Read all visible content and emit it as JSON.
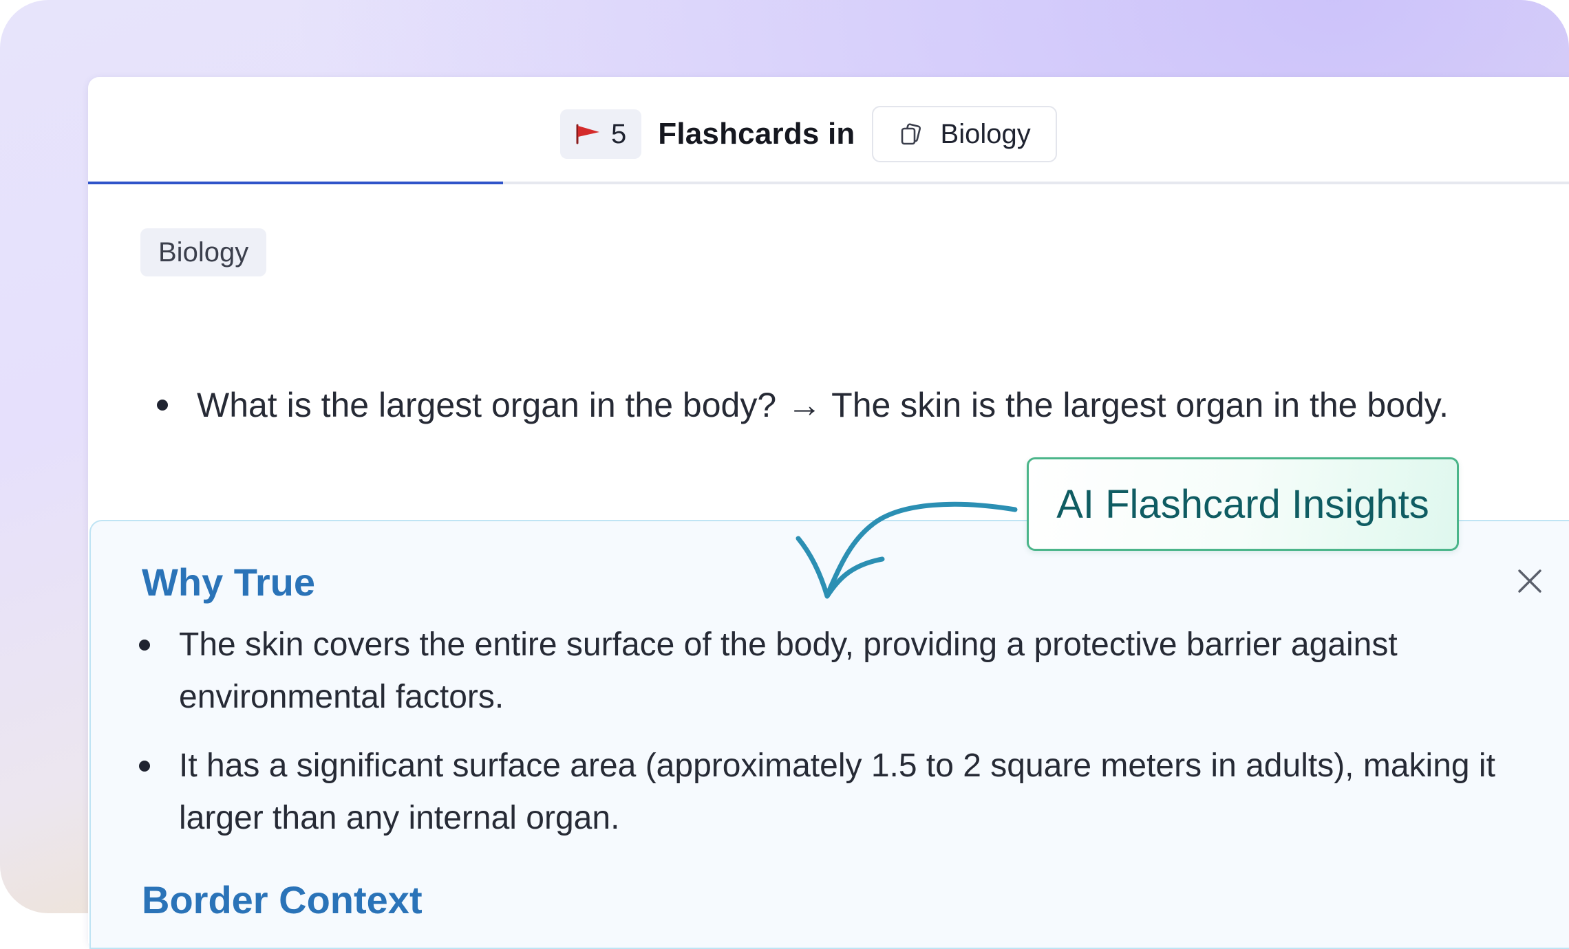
{
  "header": {
    "count": "5",
    "title": "Flashcards in",
    "deck": "Biology"
  },
  "progress": {
    "fraction": 0.274
  },
  "card": {
    "tag": "Biology",
    "question": "What is the largest organ in the body?",
    "separator": "→",
    "answer": "The skin is the largest organ in the body."
  },
  "insights": {
    "callout": "AI Flashcard Insights",
    "why_true_heading": "Why True",
    "reasons": [
      "The skin covers the entire surface of the body, providing a protective barrier against environmental factors.",
      "It has a significant surface area (approximately 1.5 to 2 square meters in adults), making it larger than any internal organ."
    ],
    "context_heading": "Border Context"
  },
  "icons": {
    "flag": "flag-icon",
    "cards": "cards-icon",
    "close": "close-icon",
    "arrow": "curved-arrow-icon"
  },
  "colors": {
    "accent": "#2f54c9",
    "heading": "#2a73b8",
    "callout_border": "#4bb58a",
    "callout_text": "#0f5c62",
    "arrow": "#2b8fb3",
    "flag": "#d42b2b"
  }
}
